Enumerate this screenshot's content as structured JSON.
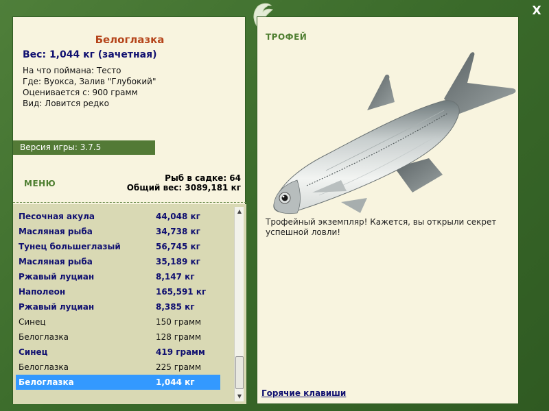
{
  "window": {
    "close_label": "X"
  },
  "fish": {
    "name": "Белоглазка",
    "weight": "Вес: 1,044 кг (зачетная)",
    "bait": "На что поймана: Тесто",
    "place": "Где: Вуокса, Залив \"Глубокий\"",
    "valued_from": "Оценивается с: 900 грамм",
    "kind": "Вид: Ловится редко"
  },
  "version": "Версия игры: 3.7.5",
  "menu_label": "МЕНЮ",
  "stats": {
    "fish_count": "Рыб в садке: 64",
    "total_weight": "Общий вес: 3089,181 кг"
  },
  "catch_list": [
    {
      "name": "Песочная акула",
      "weight": "44,048 кг",
      "trophy": true
    },
    {
      "name": "Масляная рыба",
      "weight": "34,738 кг",
      "trophy": true
    },
    {
      "name": "Тунец большеглазый",
      "weight": "56,745 кг",
      "trophy": true
    },
    {
      "name": "Масляная рыба",
      "weight": "35,189 кг",
      "trophy": true
    },
    {
      "name": "Ржавый луциан",
      "weight": "8,147 кг",
      "trophy": true
    },
    {
      "name": "Наполеон",
      "weight": "165,591 кг",
      "trophy": true
    },
    {
      "name": "Ржавый луциан",
      "weight": "8,385 кг",
      "trophy": true
    },
    {
      "name": "Синец",
      "weight": "150 грамм",
      "trophy": false
    },
    {
      "name": "Белоглазка",
      "weight": "128 грамм",
      "trophy": false
    },
    {
      "name": "Синец",
      "weight": "419 грамм",
      "trophy": true
    },
    {
      "name": "Белоглазка",
      "weight": "225 грамм",
      "trophy": false
    },
    {
      "name": "Белоглазка",
      "weight": "1,044 кг",
      "trophy": true,
      "selected": true
    }
  ],
  "trophy": {
    "label": "ТРОФЕЙ",
    "text": "Трофейный экземпляр! Кажется, вы открыли секрет успешной ловли!"
  },
  "hotkeys_link": "Горячие клавиши",
  "colors": {
    "frame": "#3c6a2c",
    "panel": "#f8f4df",
    "trophy_text": "#101070",
    "title": "#b5441a",
    "selected": "#3399ff",
    "accent_green": "#4e7e30"
  }
}
